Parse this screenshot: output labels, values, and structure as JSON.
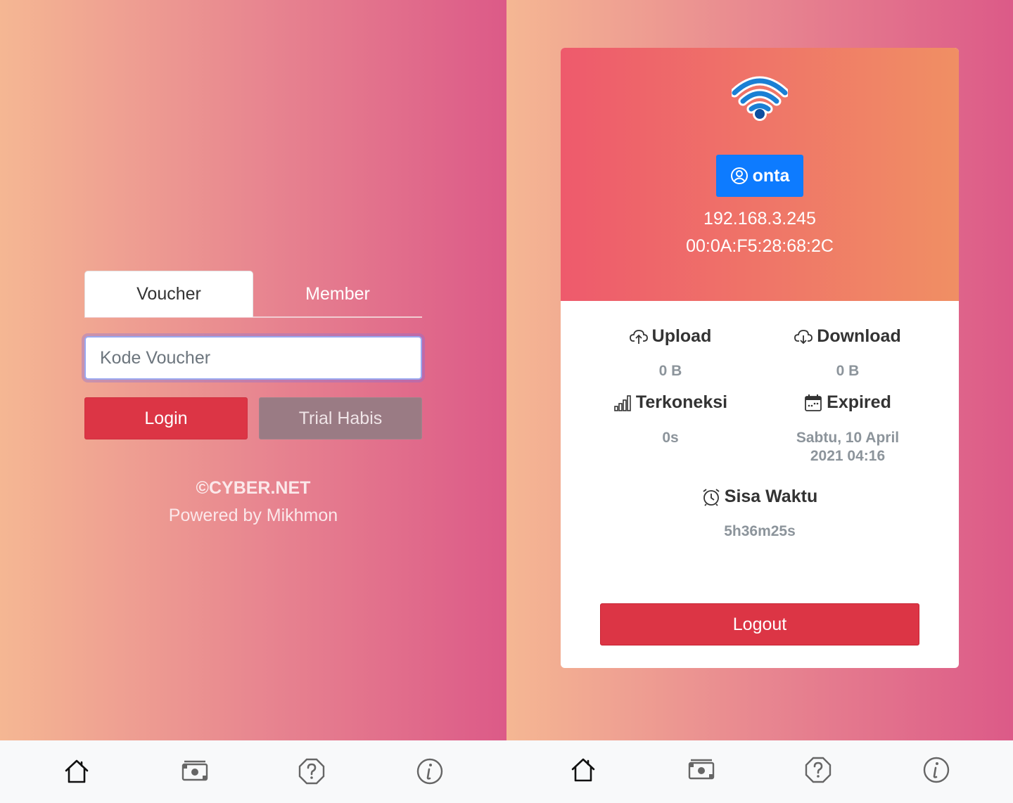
{
  "login_screen": {
    "tabs": [
      {
        "label": "Voucher",
        "active": true
      },
      {
        "label": "Member",
        "active": false
      }
    ],
    "voucher_input": {
      "placeholder": "Kode Voucher",
      "value": ""
    },
    "login_button": "Login",
    "trial_button": "Trial Habis",
    "copyright": "©CYBER.NET",
    "powered_by": "Powered by Mikhmon"
  },
  "status_screen": {
    "username": "onta",
    "ip": "192.168.3.245",
    "mac": "00:0A:F5:28:68:2C",
    "upload": {
      "label": "Upload",
      "value": "0 B"
    },
    "download": {
      "label": "Download",
      "value": "0 B"
    },
    "connected": {
      "label": "Terkoneksi",
      "value": "0s"
    },
    "expired": {
      "label": "Expired",
      "value_line1": "Sabtu, 10 April",
      "value_line2": "2021 04:16"
    },
    "remaining": {
      "label": "Sisa Waktu",
      "value": "5h36m25s"
    },
    "logout_button": "Logout"
  },
  "bottom_nav": {
    "items": [
      "home-icon",
      "cash-icon",
      "help-icon",
      "info-icon"
    ]
  },
  "colors": {
    "primary": "#0d7bff",
    "danger": "#dc3545",
    "gradient_start": "#f5b793",
    "gradient_end": "#dc5a88"
  }
}
